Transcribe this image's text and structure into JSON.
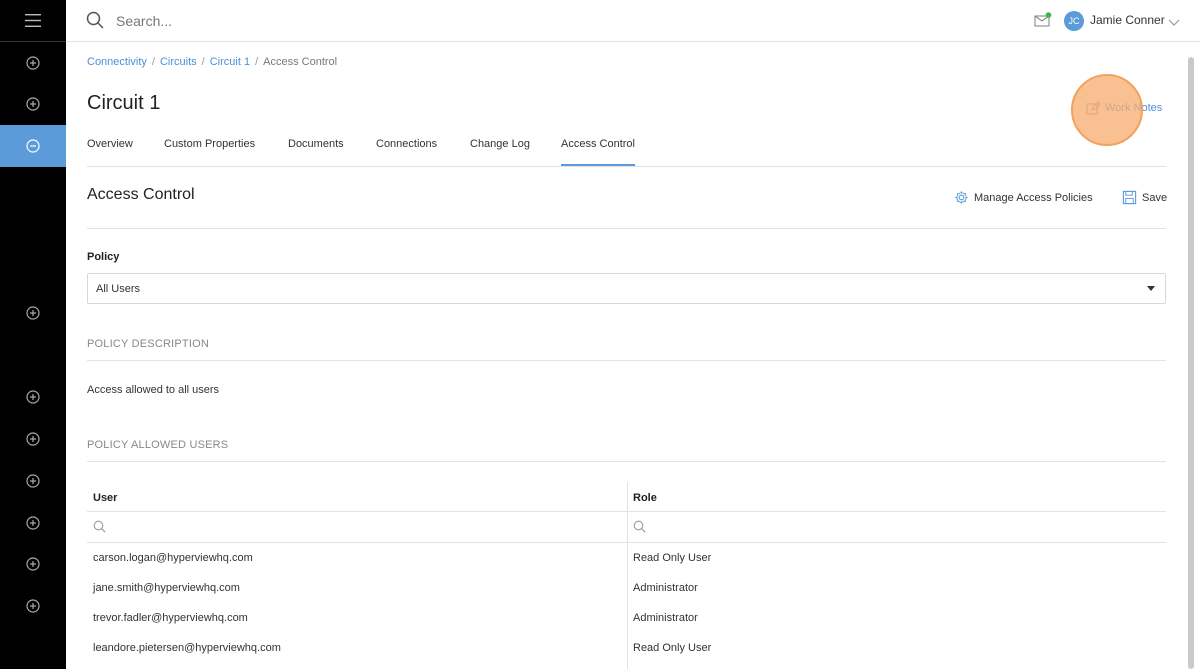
{
  "topbar": {
    "search_placeholder": "Search...",
    "user_initials": "JC",
    "user_name": "Jamie Conner"
  },
  "breadcrumb": {
    "items": [
      "Connectivity",
      "Circuits",
      "Circuit 1",
      "Access Control"
    ]
  },
  "page": {
    "title": "Circuit 1",
    "work_notes_label": "Work Notes"
  },
  "tabs": [
    {
      "label": "Overview"
    },
    {
      "label": "Custom Properties"
    },
    {
      "label": "Documents"
    },
    {
      "label": "Connections"
    },
    {
      "label": "Change Log"
    },
    {
      "label": "Access Control",
      "active": true
    }
  ],
  "access_control": {
    "title": "Access Control",
    "manage_label": "Manage Access Policies",
    "save_label": "Save",
    "policy_label": "Policy",
    "policy_value": "All Users",
    "description_heading": "POLICY DESCRIPTION",
    "description_text": "Access allowed to all users",
    "allowed_heading": "POLICY ALLOWED USERS"
  },
  "users_table": {
    "columns": [
      "User",
      "Role"
    ],
    "rows": [
      {
        "user": "carson.logan@hyperviewhq.com",
        "role": "Read Only User"
      },
      {
        "user": "jane.smith@hyperviewhq.com",
        "role": "Administrator"
      },
      {
        "user": "trevor.fadler@hyperviewhq.com",
        "role": "Administrator"
      },
      {
        "user": "leandore.pietersen@hyperviewhq.com",
        "role": "Read Only User"
      }
    ]
  },
  "colors": {
    "accent": "#5b9bd9",
    "link": "#4a90d9",
    "sidebar": "#000000",
    "highlight": "#f7ac6e",
    "notification_dot": "#3cb54a"
  },
  "icons": {
    "sidebar": [
      "menu-icon",
      "plus-circle-icon",
      "minus-circle-icon"
    ],
    "topbar": [
      "search-icon",
      "mail-icon",
      "chevron-down-icon"
    ]
  }
}
